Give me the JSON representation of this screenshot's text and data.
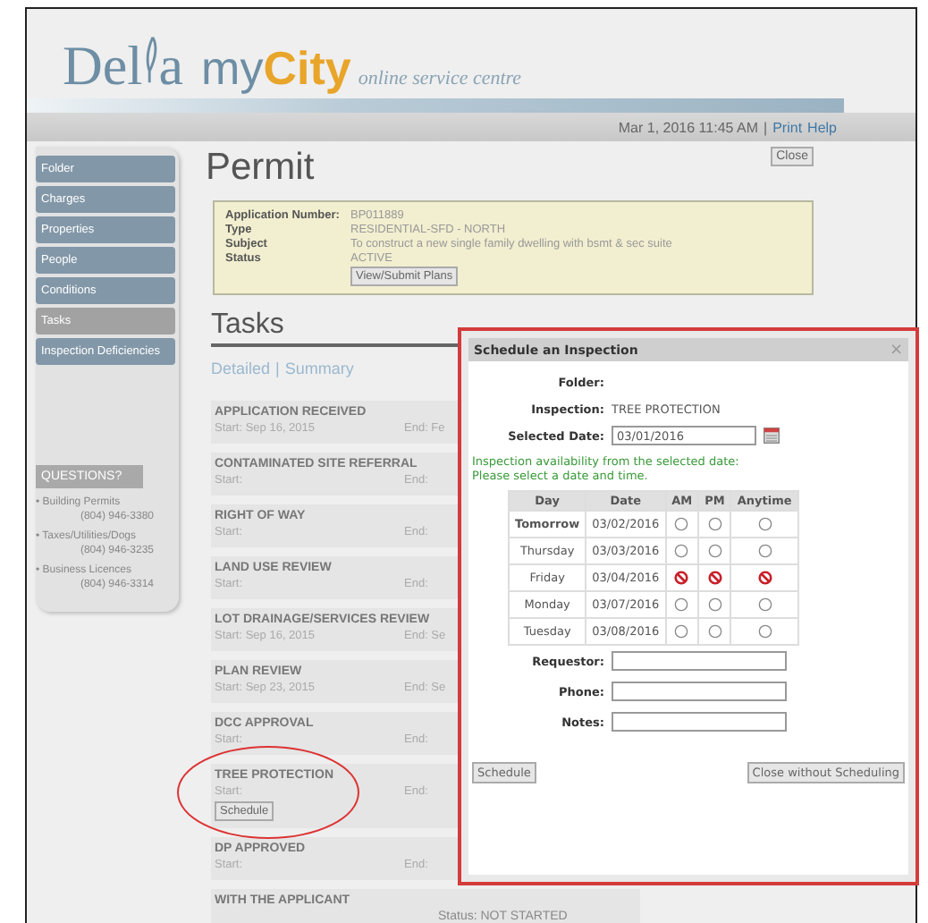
{
  "header": {
    "logo_start": "Del",
    "logo_end": "a",
    "logo_my": "my",
    "logo_city": "City",
    "tagline": "online service centre"
  },
  "datebar": {
    "datetime": "Mar 1, 2016 11:45 AM",
    "separator": "|",
    "links": [
      "Print",
      "Help"
    ]
  },
  "sidebar": {
    "items": [
      {
        "label": "Folder",
        "selected": false
      },
      {
        "label": "Charges",
        "selected": false
      },
      {
        "label": "Properties",
        "selected": false
      },
      {
        "label": "People",
        "selected": false
      },
      {
        "label": "Conditions",
        "selected": false
      },
      {
        "label": "Tasks",
        "selected": true
      },
      {
        "label": "Inspection Deficiencies",
        "selected": false
      }
    ],
    "questions": {
      "heading": "QUESTIONS?",
      "contacts": [
        {
          "label": "• Building Permits",
          "phone": "(804) 946-3380"
        },
        {
          "label": "• Taxes/Utilities/Dogs",
          "phone": "(804) 946-3235"
        },
        {
          "label": "• Business Licences",
          "phone": "(804) 946-3314"
        }
      ]
    }
  },
  "permit": {
    "title": "Permit",
    "close": "Close",
    "details": [
      {
        "label": "Application Number:",
        "value": "BP011889"
      },
      {
        "label": "Type",
        "value": "RESIDENTIAL-SFD - NORTH"
      },
      {
        "label": "Subject",
        "value": "To construct a new single family dwelling with bsmt & sec suite"
      },
      {
        "label": "Status",
        "value": "ACTIVE"
      }
    ],
    "plans_button": "View/Submit Plans"
  },
  "tasks": {
    "heading": "Tasks",
    "views": [
      "Detailed",
      "Summary"
    ],
    "view_separator": "|",
    "rows": [
      {
        "name": "APPLICATION RECEIVED",
        "start": "Start: Sep 16, 2015",
        "end": "End: Fe"
      },
      {
        "name": "CONTAMINATED SITE REFERRAL",
        "start": "Start:",
        "end": "End:"
      },
      {
        "name": "RIGHT OF WAY",
        "start": "Start:",
        "end": "End:"
      },
      {
        "name": "LAND USE REVIEW",
        "start": "Start:",
        "end": "End:"
      },
      {
        "name": "LOT DRAINAGE/SERVICES REVIEW",
        "start": "Start: Sep 16, 2015",
        "end": "End: Se"
      },
      {
        "name": "PLAN REVIEW",
        "start": "Start: Sep 23, 2015",
        "end": "End: Se"
      },
      {
        "name": "DCC APPROVAL",
        "start": "Start:",
        "end": "End:"
      },
      {
        "name": "TREE PROTECTION",
        "start": "Start:",
        "end": "End:",
        "action": "Schedule"
      },
      {
        "name": "DP APPROVED",
        "start": "Start:",
        "end": "End:"
      },
      {
        "name": "WITH THE APPLICANT",
        "status": "Status: NOT STARTED"
      }
    ]
  },
  "dialog": {
    "title": "Schedule an Inspection",
    "close": "×",
    "folder_label": "Folder:",
    "inspection_label": "Inspection:",
    "inspection_value": "TREE PROTECTION",
    "date_label": "Selected Date:",
    "date_value": "03/01/2016",
    "notice": [
      "Inspection availability from the selected date:",
      "Please select a date and time."
    ],
    "columns": [
      "Day",
      "Date",
      "AM",
      "PM",
      "Anytime"
    ],
    "rows": [
      {
        "day": "Tomorrow",
        "emphasized": true,
        "date": "03/02/2016",
        "slots": [
          {
            "available": true
          },
          {
            "available": true
          },
          {
            "available": true
          }
        ]
      },
      {
        "day": "Thursday",
        "emphasized": false,
        "date": "03/03/2016",
        "slots": [
          {
            "available": true
          },
          {
            "available": true
          },
          {
            "available": true
          }
        ]
      },
      {
        "day": "Friday",
        "emphasized": false,
        "date": "03/04/2016",
        "slots": [
          {
            "available": false
          },
          {
            "available": false
          },
          {
            "available": false
          }
        ]
      },
      {
        "day": "Monday",
        "emphasized": false,
        "date": "03/07/2016",
        "slots": [
          {
            "available": true
          },
          {
            "available": true
          },
          {
            "available": true
          }
        ]
      },
      {
        "day": "Tuesday",
        "emphasized": false,
        "date": "03/08/2016",
        "slots": [
          {
            "available": true
          },
          {
            "available": true
          },
          {
            "available": true
          }
        ]
      }
    ],
    "fields": [
      "Requestor:",
      "Phone:",
      "Notes:"
    ],
    "schedule_button": "Schedule",
    "cancel_button": "Close without Scheduling"
  }
}
